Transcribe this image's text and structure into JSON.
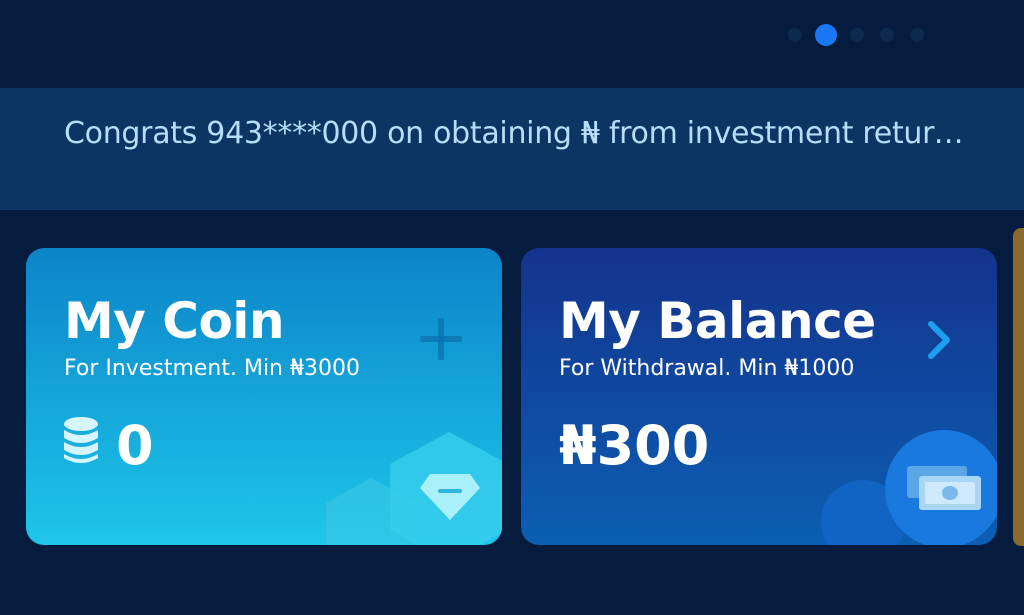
{
  "carousel": {
    "dot_count": 5,
    "active_index": 1,
    "active_color": "#1a78f5"
  },
  "ticker": {
    "text": "Congrats 943****000 on obtaining ₦ from investment return..."
  },
  "coin_card": {
    "title": "My Coin",
    "subtitle": "For Investment. Min ₦3000",
    "value": "0",
    "icons": [
      "coin-stack-icon",
      "plus-icon",
      "diamond-icon"
    ]
  },
  "balance_card": {
    "title": "My Balance",
    "subtitle": "For Withdrawal. Min ₦1000",
    "value": "₦300",
    "icons": [
      "chevron-right-icon",
      "money-icon"
    ]
  },
  "colors": {
    "background": "#051c3f",
    "ticker_bg": "#0b3664",
    "ticker_text": "#b6def8",
    "coin_card_top": "#0c84c8",
    "coin_card_bottom": "#1ec6ea",
    "balance_card_top": "#14338d",
    "balance_card_bottom": "#0b5fb3"
  }
}
